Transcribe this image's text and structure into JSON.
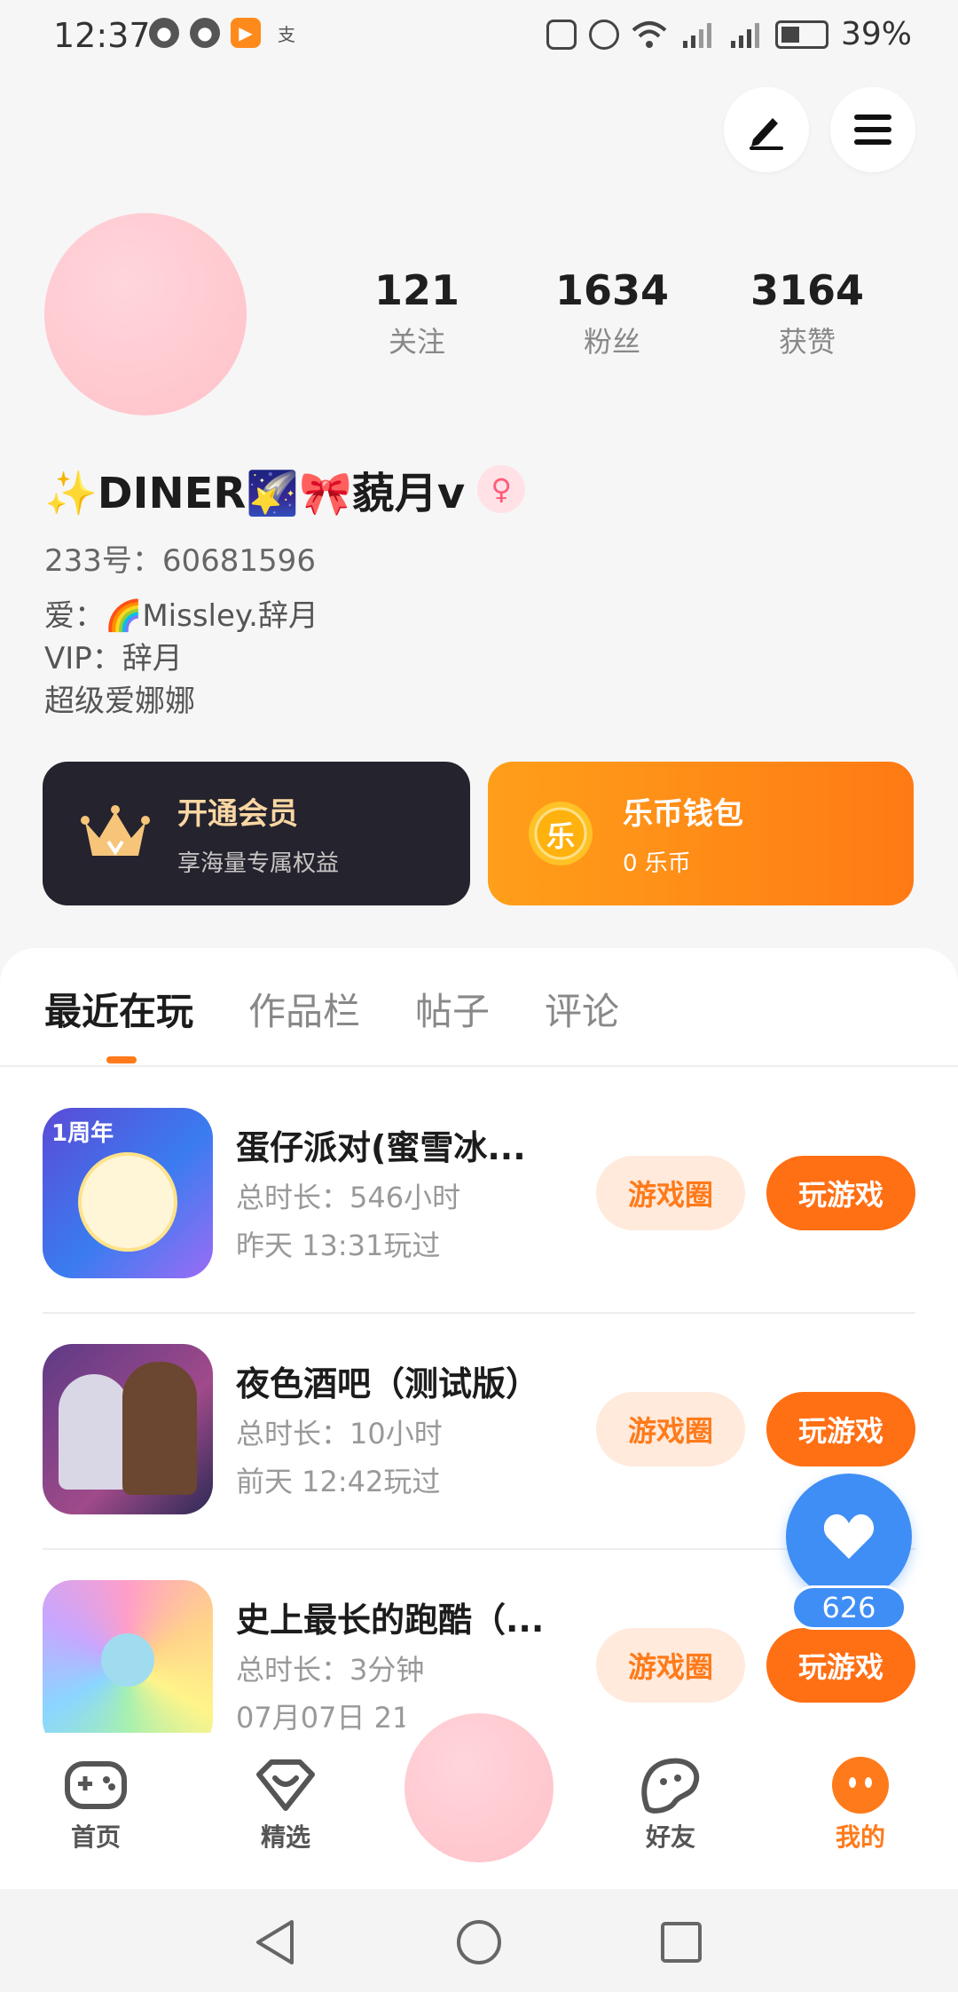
{
  "status_bar": {
    "time": "12:37",
    "battery": "39%"
  },
  "profile": {
    "stats": [
      {
        "value": "121",
        "label": "关注"
      },
      {
        "value": "1634",
        "label": "粉丝"
      },
      {
        "value": "3164",
        "label": "获赞"
      }
    ],
    "name": "✨DINER🌠🎀藐月v",
    "gender_icon": "female-icon",
    "uid": "233号：60681596",
    "bio_lines": [
      "爱：🌈Missley.辞月",
      "VIP：辞月",
      "超级爱娜娜"
    ]
  },
  "cards": {
    "vip": {
      "title": "开通会员",
      "subtitle": "享海量专属权益"
    },
    "wallet": {
      "title": "乐币钱包",
      "subtitle": "0 乐币",
      "coin_glyph": "乐"
    }
  },
  "tabs": [
    "最近在玩",
    "作品栏",
    "帖子",
    "评论"
  ],
  "games": [
    {
      "name": "蛋仔派对(蜜雪冰...",
      "duration": "总时长：546小时",
      "last": "昨天 13:31玩过",
      "icon_badge": "1周年"
    },
    {
      "name": "夜色酒吧（测试版）",
      "duration": "总时长：10小时",
      "last": "前天 12:42玩过"
    },
    {
      "name": "史上最长的跑酷（...",
      "duration": "总时长：3分钟",
      "last": "07月07日 21..."
    }
  ],
  "game_buttons": {
    "circle": "游戏圈",
    "play": "玩游戏"
  },
  "like_fab": {
    "count": "626"
  },
  "bottom_nav": [
    {
      "label": "首页",
      "icon": "gamepad-icon"
    },
    {
      "label": "精选",
      "icon": "heart-box-icon"
    },
    {
      "label": "好友",
      "icon": "friend-face-icon"
    },
    {
      "label": "我的",
      "icon": "me-icon"
    }
  ],
  "colors": {
    "accent": "#ff7a1a",
    "blue": "#3f8ef5",
    "dark_card": "#25232e"
  }
}
